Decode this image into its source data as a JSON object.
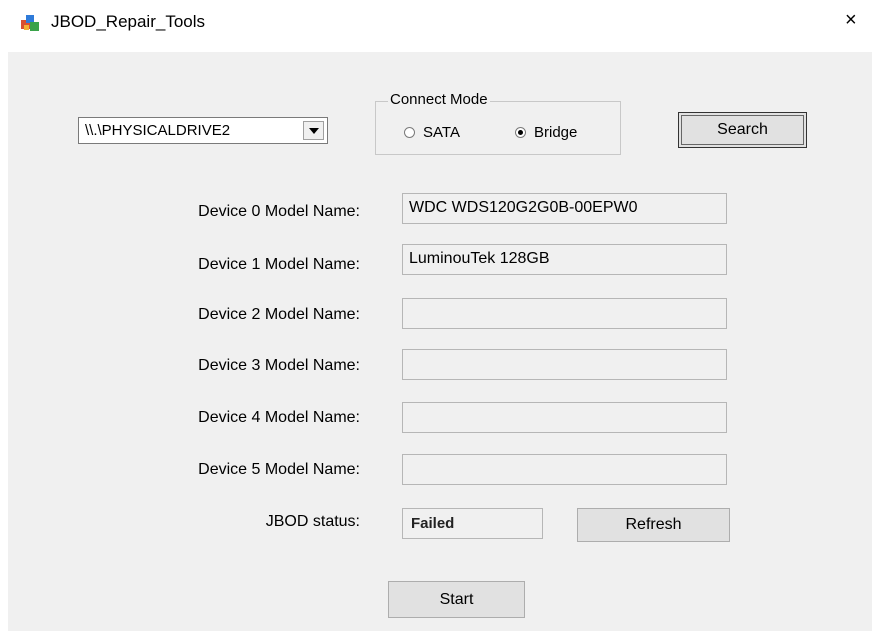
{
  "window": {
    "title": "JBOD_Repair_Tools",
    "close_glyph": "×",
    "app_icon": "jbod-app-icon"
  },
  "drive_select": {
    "value": "\\\\.\\PHYSICALDRIVE2"
  },
  "connect_mode": {
    "label": "Connect Mode",
    "options": [
      {
        "label": "SATA",
        "selected": false
      },
      {
        "label": "Bridge",
        "selected": true
      }
    ]
  },
  "buttons": {
    "search": "Search",
    "refresh": "Refresh",
    "start": "Start"
  },
  "devices": [
    {
      "label": "Device 0 Model Name:",
      "value": "WDC WDS120G2G0B-00EPW0"
    },
    {
      "label": "Device 1 Model Name:",
      "value": "LuminouTek  128GB"
    },
    {
      "label": "Device 2 Model Name:",
      "value": ""
    },
    {
      "label": "Device 3 Model Name:",
      "value": ""
    },
    {
      "label": "Device 4 Model Name:",
      "value": ""
    },
    {
      "label": "Device 5 Model Name:",
      "value": ""
    }
  ],
  "jbod": {
    "label": "JBOD status:",
    "value": "Failed"
  }
}
